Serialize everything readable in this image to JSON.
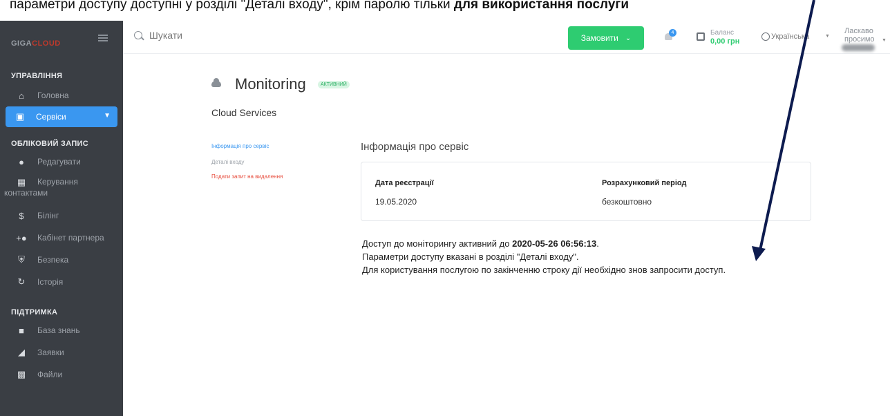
{
  "caption": {
    "text_before": "параметри доступу доступні у розділі \"Деталі входу\", крім паролю тільки ",
    "text_bold": "для використання послуги",
    "text_after": ""
  },
  "sidebar": {
    "logo_main": "GIGA",
    "logo_accent": "CLOUD",
    "section_manage": "УПРАВЛІННЯ",
    "item_home": "Головна",
    "item_services": "Сервіси",
    "section_account": "ОБЛІКОВИЙ ЗАПИС",
    "item_edit": "Редагувати",
    "item_contacts_1": "Керування",
    "item_contacts_2": "контактами",
    "item_billing": "Білінг",
    "item_partner": "Кабінет партнера",
    "item_security": "Безпека",
    "item_history": "Історія",
    "section_support": "ПІДТРИМКА",
    "item_kb": "База знань",
    "item_tickets": "Заявки",
    "item_files": "Файли"
  },
  "topbar": {
    "search_placeholder": "Шукати",
    "order_label": "Замовити",
    "notif_count": "4",
    "balance_label": "Баланс",
    "balance_value": "0,00 грн",
    "language": "Українська",
    "welcome_1": "Ласкаво",
    "welcome_2": "просимо"
  },
  "main": {
    "title": "Monitoring",
    "status": "АКТИВНИЙ",
    "subtitle": "Cloud Services",
    "links": [
      "Інформація про сервіс",
      "Деталі входу",
      "Подати запит на видалення"
    ],
    "section_title": "Інформація про сервіс",
    "reg_date_label": "Дата реєстрації",
    "reg_date_value": "19.05.2020",
    "period_label": "Розрахунковий період",
    "period_value": "безкоштовно",
    "notice_1_pre": "Доступ до моніторингу активний до ",
    "notice_1_bold": "2020-05-26 06:56:13",
    "notice_1_post": ".",
    "notice_2": "Параметри доступу вказані в розділі \"Деталі входу\".",
    "notice_3": "Для користування послугою по закінченню строку дії необхідно знов запросити доступ."
  },
  "colors": {
    "sidebar_bg": "#3a3e44",
    "accent_blue": "#3a97f0",
    "accent_green": "#2ecc71",
    "danger": "#e74c3c",
    "arrow": "#0d1b4f"
  }
}
